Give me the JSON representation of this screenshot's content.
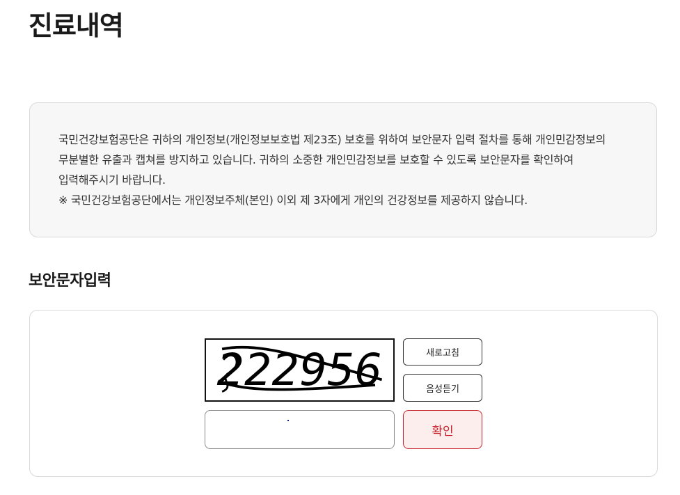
{
  "page": {
    "title": "진료내역"
  },
  "notice": {
    "lines": [
      "국민건강보험공단은 귀하의 개인정보(개인정보보호법 제23조) 보호를 위하여 보안문자 입력 절차를 통해 개인민감정보의 무분별한 유출과 캡쳐를 방지하고 있습니다. 귀하의 소중한 개인민감정보를 보호할 수 있도록 보안문자를 확인하여 입력해주시기 바랍니다.",
      "※ 국민건강보험공단에서는 개인정보주체(본인) 이외 제 3자에게 개인의 건강정보를 제공하지 않습니다."
    ]
  },
  "captcha_section": {
    "title": "보안문자입력",
    "captcha_text": "222956",
    "input": {
      "value": "",
      "placeholder": ""
    },
    "buttons": {
      "refresh_label": "새로고침",
      "audio_label": "음성듣기",
      "confirm_label": "확인"
    }
  },
  "colors": {
    "accent_red": "#c8222a",
    "confirm_bg": "#fdeeee",
    "notice_bg": "#f7f7f7",
    "border_gray": "#d9d9d9"
  }
}
